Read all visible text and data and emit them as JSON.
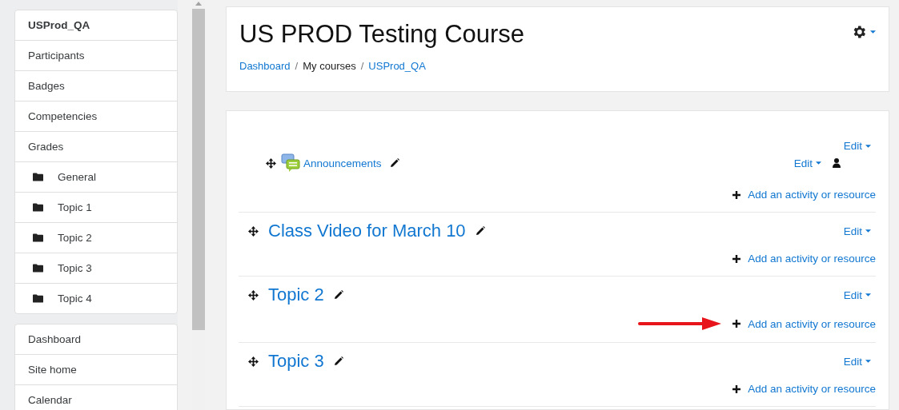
{
  "sidebar": {
    "groups": [
      {
        "items": [
          {
            "label": "USProd_QA",
            "kind": "header"
          },
          {
            "label": "Participants",
            "kind": "item"
          },
          {
            "label": "Badges",
            "kind": "item"
          },
          {
            "label": "Competencies",
            "kind": "item"
          },
          {
            "label": "Grades",
            "kind": "item"
          },
          {
            "label": "General",
            "kind": "folder"
          },
          {
            "label": "Topic 1",
            "kind": "folder"
          },
          {
            "label": "Topic 2",
            "kind": "folder"
          },
          {
            "label": "Topic 3",
            "kind": "folder"
          },
          {
            "label": "Topic 4",
            "kind": "folder"
          }
        ]
      },
      {
        "items": [
          {
            "label": "Dashboard",
            "kind": "item"
          },
          {
            "label": "Site home",
            "kind": "item"
          },
          {
            "label": "Calendar",
            "kind": "item"
          }
        ]
      }
    ]
  },
  "header": {
    "title": "US PROD Testing Course",
    "breadcrumb": [
      {
        "label": "Dashboard",
        "link": true
      },
      {
        "separator": "/",
        "label": "My courses",
        "link": false
      },
      {
        "separator": "/",
        "label": "USProd_QA",
        "link": true
      }
    ]
  },
  "sections": [
    {
      "edit": "Edit",
      "activities": [
        {
          "name": "Announcements",
          "edit": "Edit"
        }
      ],
      "add": "Add an activity or resource",
      "arrow_annotation": false
    },
    {
      "title": "Class Video for March 10",
      "edit": "Edit",
      "add": "Add an activity or resource",
      "arrow_annotation": false
    },
    {
      "title": "Topic 2",
      "edit": "Edit",
      "add": "Add an activity or resource",
      "arrow_annotation": true
    },
    {
      "title": "Topic 3",
      "edit": "Edit",
      "add": "Add an activity or resource",
      "arrow_annotation": false
    }
  ]
}
